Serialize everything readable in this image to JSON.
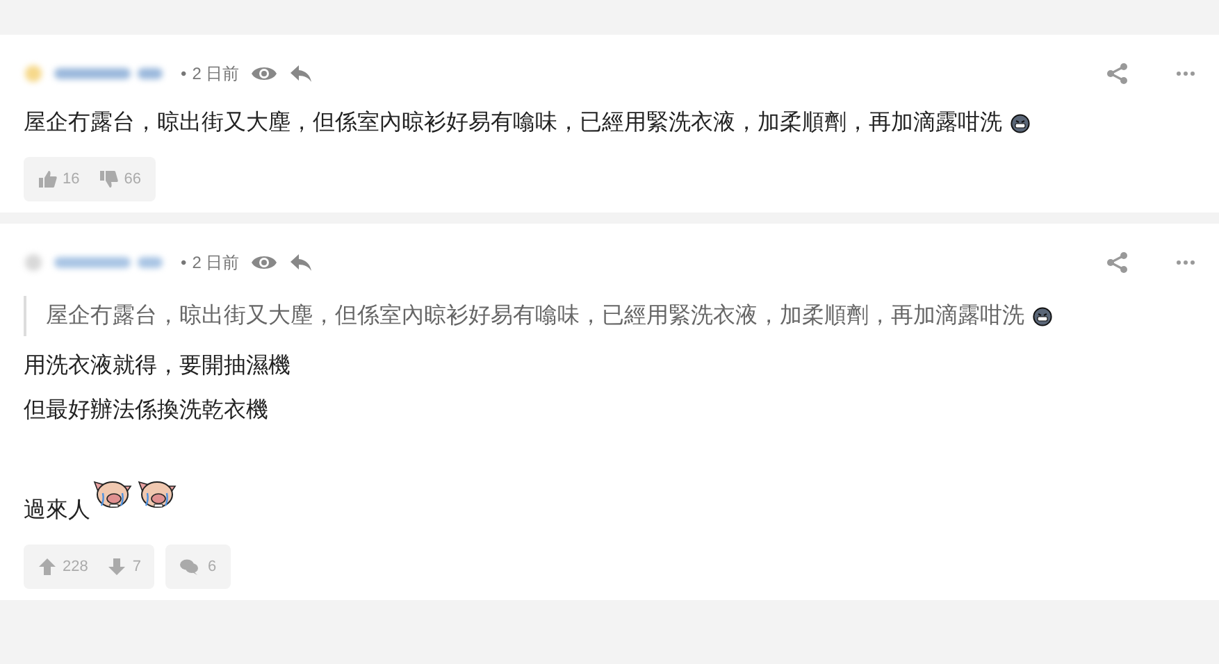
{
  "comments": [
    {
      "separator": "•",
      "time": "2 日前",
      "paragraphs": [
        {
          "lines": [
            "屋企冇露台，晾出街又大塵，但係室內晾衫好易有噏味，已經用緊洗衣液，加柔順劑，再加滴露咁洗"
          ],
          "stickers": [
            {
              "kind": "grimace"
            }
          ]
        }
      ],
      "votes": {
        "kind": "thumbs",
        "up": "16",
        "down": "66"
      }
    },
    {
      "separator": "•",
      "time": "2 日前",
      "quote": {
        "text": "屋企冇露台，晾出街又大塵，但係室內晾衫好易有噏味，已經用緊洗衣液，加柔順劑，再加滴露咁洗",
        "stickers": [
          {
            "kind": "grimace"
          }
        ]
      },
      "paragraphs": [
        {
          "lines": [
            "用洗衣液就得，要開抽濕機",
            "但最好辦法係換洗乾衣機"
          ]
        },
        {
          "lines": [
            "過來人"
          ],
          "stickers": [
            {
              "kind": "pig"
            },
            {
              "kind": "pig"
            }
          ]
        }
      ],
      "votes": {
        "kind": "arrows",
        "up": "228",
        "down": "7"
      },
      "replies": "6"
    }
  ]
}
